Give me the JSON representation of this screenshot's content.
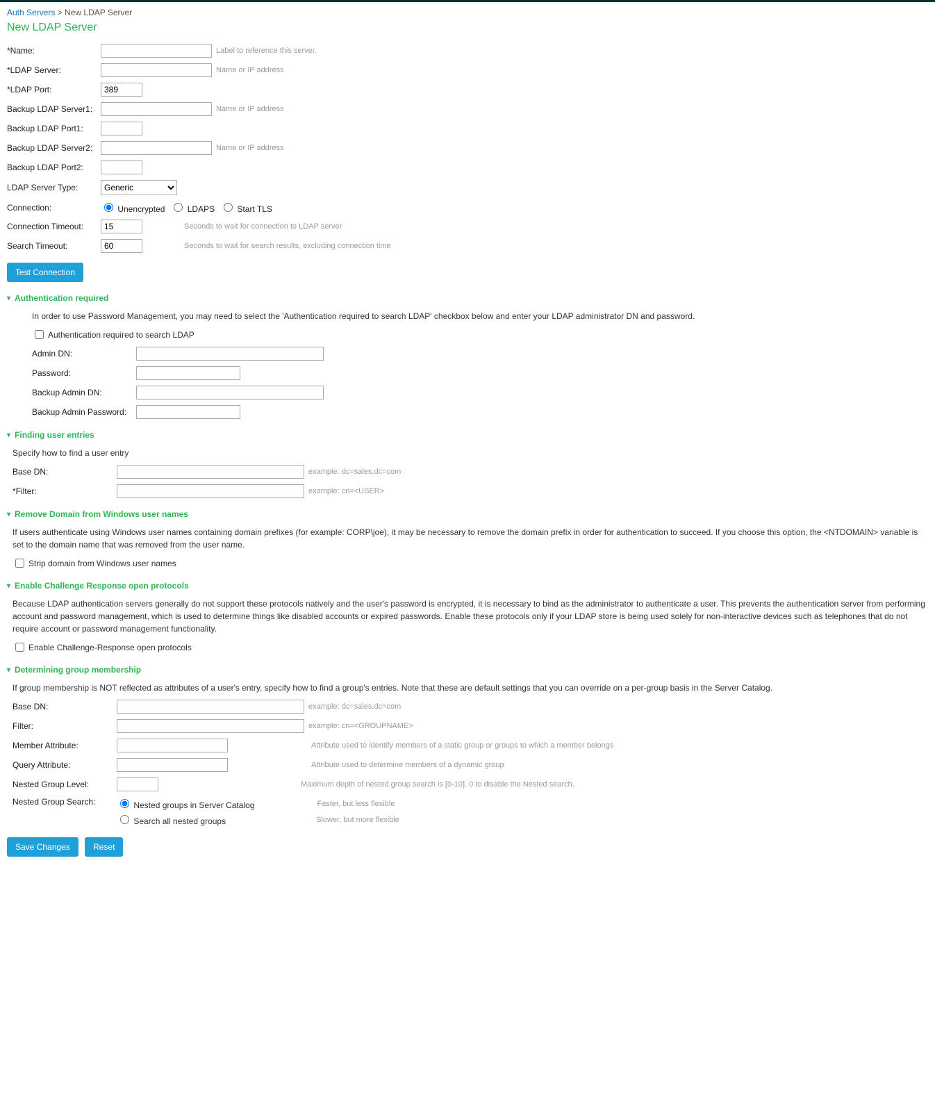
{
  "breadcrumb": {
    "link": "Auth Servers",
    "sep": ">",
    "current": "New LDAP Server"
  },
  "title": "New LDAP Server",
  "basic": {
    "name_lbl": "*Name:",
    "name_val": "",
    "name_hint": "Label to reference this server.",
    "server_lbl": "*LDAP Server:",
    "server_val": "",
    "server_hint": "Name or IP address",
    "port_lbl": "*LDAP Port:",
    "port_val": "389",
    "b1s_lbl": "Backup LDAP Server1:",
    "b1s_val": "",
    "b1s_hint": "Name or IP address",
    "b1p_lbl": "Backup LDAP Port1:",
    "b1p_val": "",
    "b2s_lbl": "Backup LDAP Server2:",
    "b2s_val": "",
    "b2s_hint": "Name or IP address",
    "b2p_lbl": "Backup LDAP Port2:",
    "b2p_val": "",
    "type_lbl": "LDAP Server Type:",
    "type_val": "Generic",
    "conn_lbl": "Connection:",
    "conn_opt1": "Unencrypted",
    "conn_opt2": "LDAPS",
    "conn_opt3": "Start TLS",
    "ct_lbl": "Connection Timeout:",
    "ct_val": "15",
    "ct_hint": "Seconds to wait for connection to LDAP server",
    "st_lbl": "Search Timeout:",
    "st_val": "60",
    "st_hint": "Seconds to wait for search results, excluding connection time",
    "test_btn": "Test Connection"
  },
  "auth": {
    "head": "Authentication required",
    "desc": "In order to use Password Management, you may need to select the 'Authentication required to search LDAP' checkbox below and enter your LDAP administrator DN and password.",
    "chk_lbl": "Authentication required to search LDAP",
    "admin_dn_lbl": "Admin DN:",
    "admin_dn_val": "",
    "pwd_lbl": "Password:",
    "pwd_val": "",
    "b_admin_dn_lbl": "Backup Admin DN:",
    "b_admin_dn_val": "",
    "b_pwd_lbl": "Backup Admin Password:",
    "b_pwd_val": ""
  },
  "find": {
    "head": "Finding user entries",
    "desc": "Specify how to find a user entry",
    "base_lbl": "Base DN:",
    "base_val": "",
    "base_hint": "example: dc=sales,dc=com",
    "filter_lbl": "*Filter:",
    "filter_val": "",
    "filter_hint": "example: cn=<USER>"
  },
  "domain": {
    "head": "Remove Domain from Windows user names",
    "desc": "If users authenticate using Windows user names containing domain prefixes (for example: CORP\\joe), it may be necessary to remove the domain prefix in order for authentication to succeed. If you choose this option, the <NTDOMAIN> variable is set to the domain name that was removed from the user name.",
    "chk_lbl": "Strip domain from Windows user names"
  },
  "cr": {
    "head": "Enable Challenge Response open protocols",
    "desc": "Because LDAP authentication servers generally do not support these protocols natively and the user's password is encrypted, it is necessary to bind as the administrator to authenticate a user. This prevents the authentication server from performing account and password management, which is used to determine things like disabled accounts or expired passwords. Enable these protocols only if your LDAP store is being used solely for non-interactive devices such as telephones that do not require account or password management functionality.",
    "chk_lbl": "Enable Challenge-Response open protocols"
  },
  "group": {
    "head": "Determining group membership",
    "desc": "If group membership is NOT reflected as attributes of a user's entry, specify how to find a group's entries. Note that these are default settings that you can override on a per-group basis in the Server Catalog.",
    "base_lbl": "Base DN:",
    "base_val": "",
    "base_hint": "example: dc=sales,dc=com",
    "filter_lbl": "Filter:",
    "filter_val": "",
    "filter_hint": "example: cn=<GROUPNAME>",
    "member_lbl": "Member Attribute:",
    "member_val": "",
    "member_hint": "Attribute used to identify members of a static group or groups to which a member belongs",
    "query_lbl": "Query Attribute:",
    "query_val": "",
    "query_hint": "Attribute used to determine members of a dynamic group",
    "level_lbl": "Nested Group Level:",
    "level_val": "",
    "level_hint": "Maximum depth of nested group search is [0-10]. 0 to disable the Nested search.",
    "search_lbl": "Nested Group Search:",
    "opt1": "Nested groups in Server Catalog",
    "opt1_hint": "Faster, but less flexible",
    "opt2": "Search all nested groups",
    "opt2_hint": "Slower, but more flexible"
  },
  "footer": {
    "save": "Save Changes",
    "reset": "Reset"
  }
}
